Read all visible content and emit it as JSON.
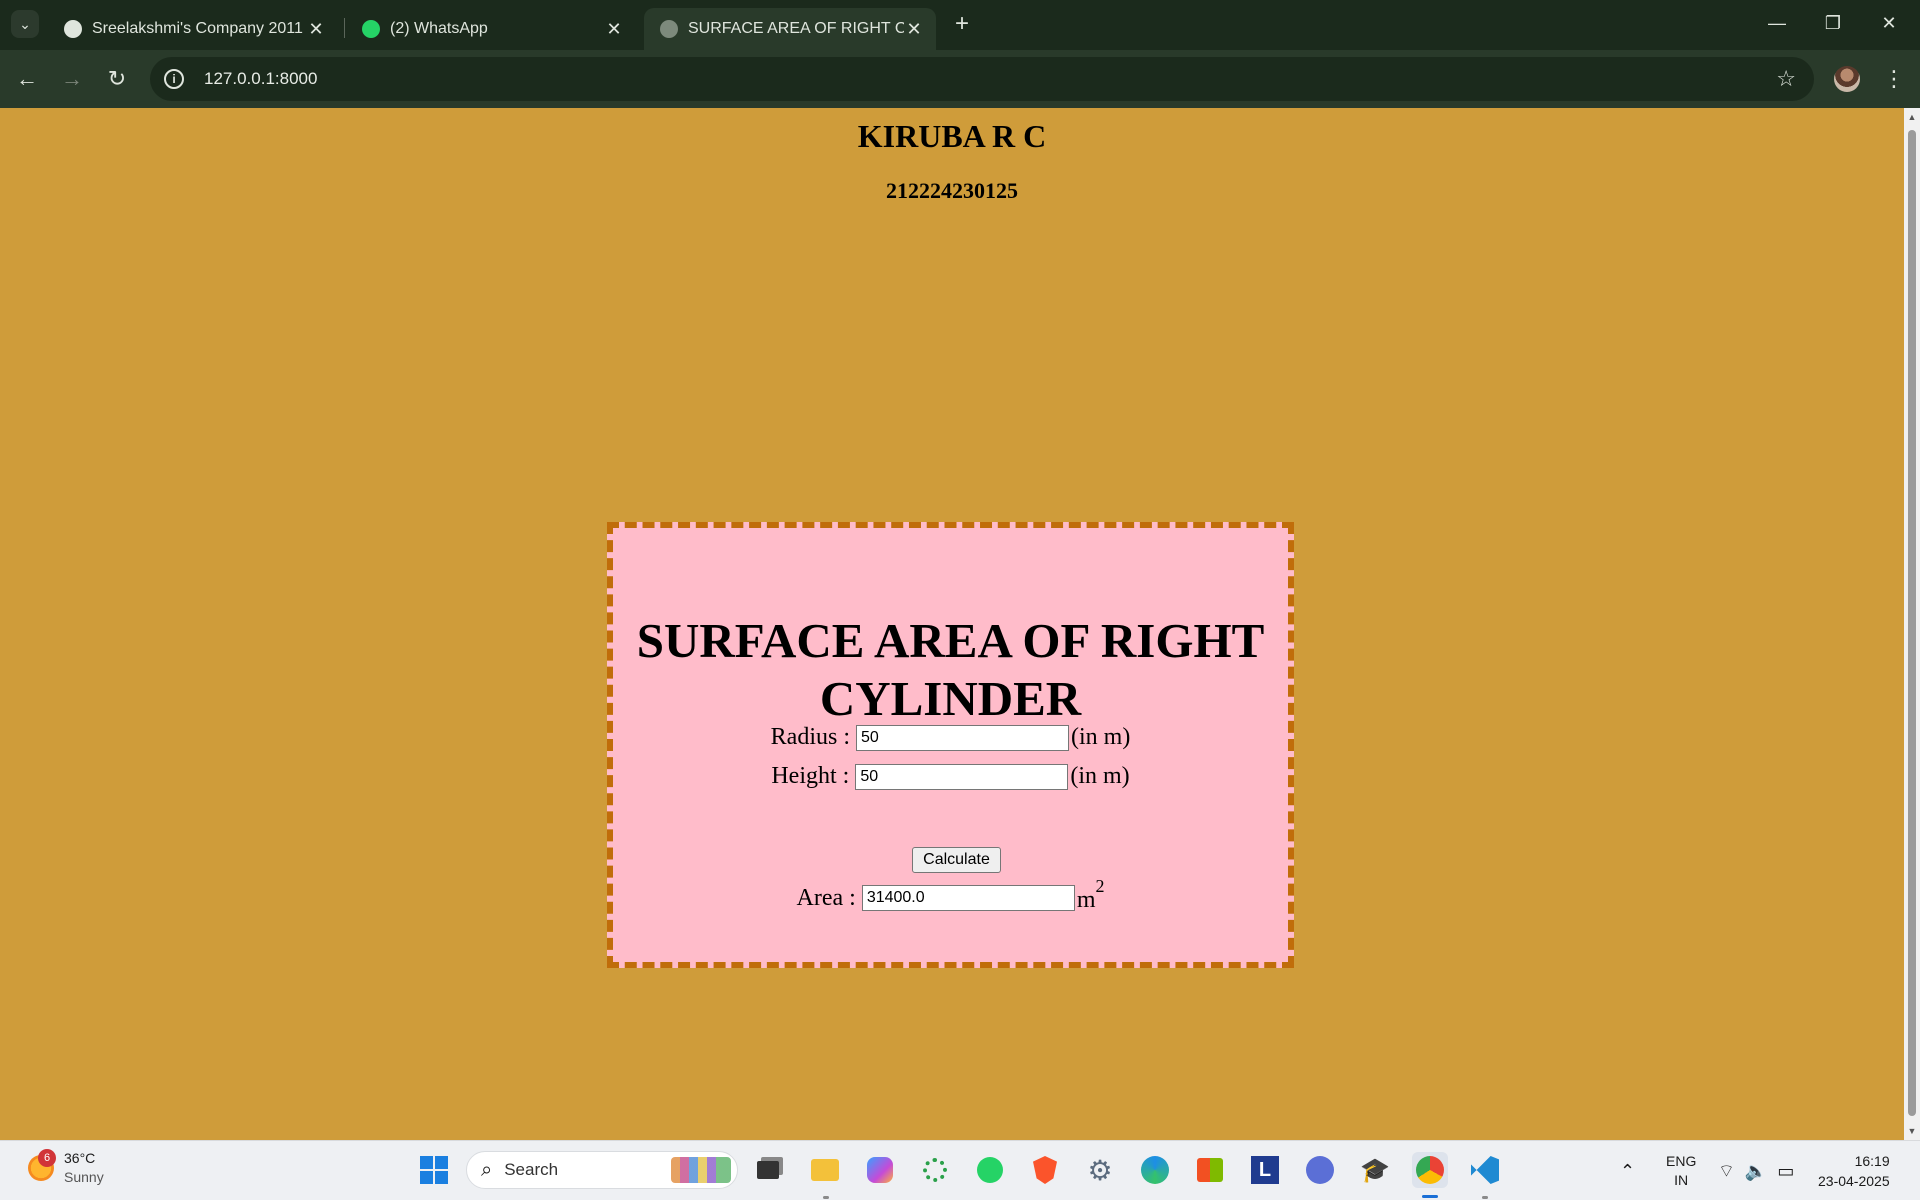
{
  "browser": {
    "tabs": [
      {
        "title": "Sreelakshmi's Company 2011",
        "active": false,
        "favicon": "openai-icon"
      },
      {
        "title": "(2) WhatsApp",
        "active": false,
        "favicon": "whatsapp-icon"
      },
      {
        "title": "SURFACE AREA OF RIGHT CYLIN",
        "active": true,
        "favicon": "globe-icon"
      }
    ],
    "url": "127.0.0.1:8000"
  },
  "page": {
    "name": "KIRUBA R C",
    "register_number": "212224230125",
    "heading": "SURFACE AREA OF RIGHT CYLINDER",
    "radius": {
      "label": "Radius :",
      "value": "50",
      "unit": "(in m)"
    },
    "height": {
      "label": "Height :",
      "value": "50",
      "unit": "(in m)"
    },
    "calculate_label": "Calculate",
    "area": {
      "label": "Area :",
      "value": "31400.0",
      "unit": "m",
      "unit_sup": "2"
    }
  },
  "taskbar": {
    "weather": {
      "temperature": "36°C",
      "condition": "Sunny",
      "badge": "6"
    },
    "search_placeholder": "Search",
    "language": {
      "line1": "ENG",
      "line2": "IN"
    },
    "time": "16:19",
    "date": "23-04-2025"
  }
}
